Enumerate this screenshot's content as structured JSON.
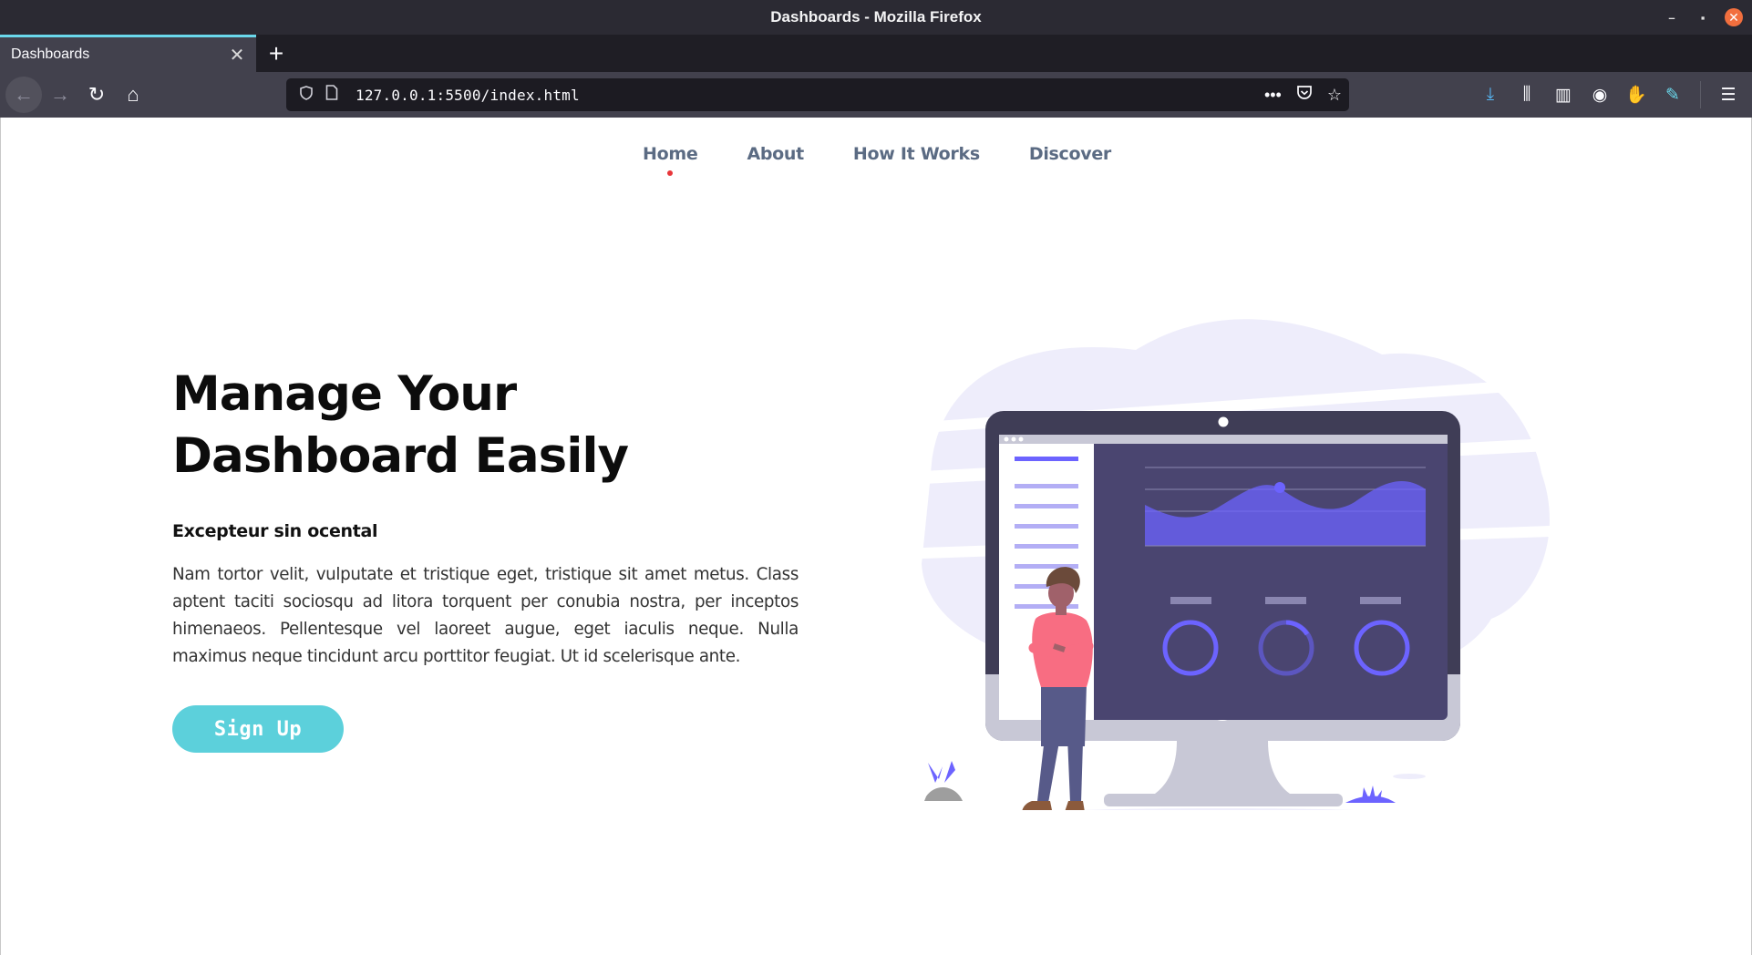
{
  "window": {
    "title": "Dashboards - Mozilla Firefox",
    "minimize": "–",
    "maximize": "▪",
    "close": "✕"
  },
  "tabs": [
    {
      "label": "Dashboards",
      "close": "✕"
    }
  ],
  "new_tab": "+",
  "toolbar": {
    "back": "←",
    "forward": "→",
    "reload": "↻",
    "home": "⌂",
    "url": "127.0.0.1:5500/index.html",
    "page_actions": "•••",
    "pocket": "◘",
    "bookmark_star": "☆",
    "downloads": "⤓",
    "library": "⫼",
    "sidebar": "▥",
    "account": "◉",
    "extension_gnome": "✋",
    "extension_color": "✎",
    "menu": "☰"
  },
  "site_nav": [
    {
      "label": "Home",
      "active": true
    },
    {
      "label": "About",
      "active": false
    },
    {
      "label": "How It Works",
      "active": false
    },
    {
      "label": "Discover",
      "active": false
    }
  ],
  "hero": {
    "title_line1": "Manage Your",
    "title_line2": "Dashboard Easily",
    "subtitle": "Excepteur sin ocental",
    "body": "Nam tortor velit, vulputate et tristique eget, tristique sit amet metus. Class aptent taciti sociosqu ad litora torquent per conubia nostra, per inceptos himenaeos. Pellentesque vel laoreet augue, eget iaculis neque. Nulla maximus neque tincidunt arcu porttitor feugiat. Ut id scelerisque ante.",
    "cta": "Sign Up"
  },
  "colors": {
    "accent": "#5cd0db",
    "nav_text": "#5b6b83",
    "active_dot": "#e8363a",
    "illustration_purple": "#6c63ff",
    "monitor_dark": "#3f3d56",
    "blob": "#eeedfb",
    "figure_shirt": "#f86d82"
  }
}
